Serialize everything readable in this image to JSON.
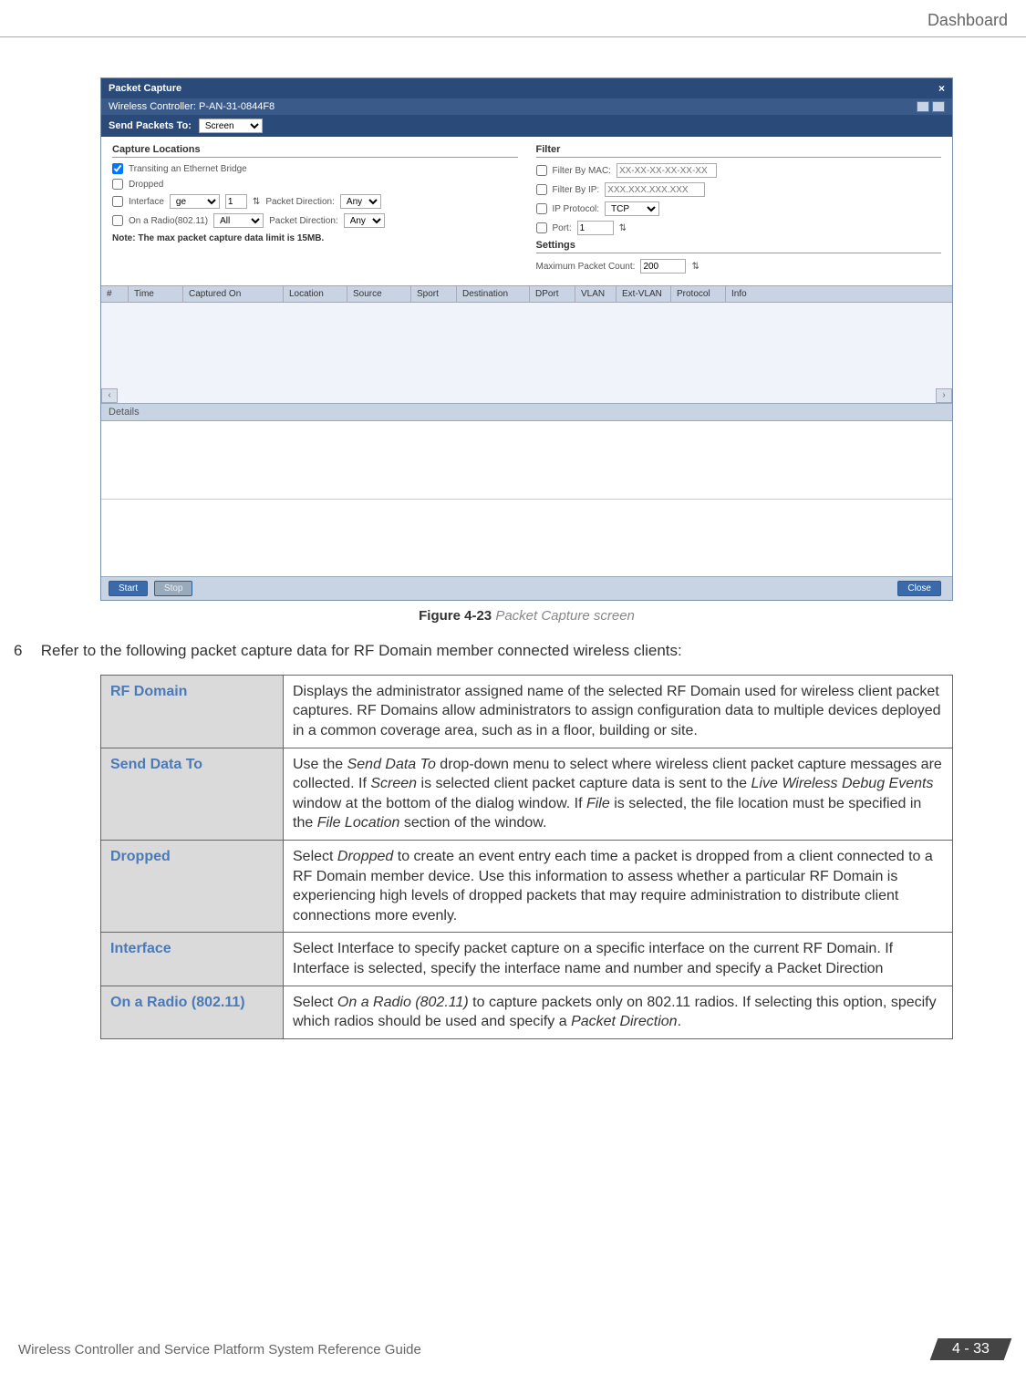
{
  "header": {
    "section": "Dashboard"
  },
  "screenshot": {
    "title": "Packet Capture",
    "controller": "Wireless Controller: P-AN-31-0844F8",
    "send_packets_label": "Send Packets To:",
    "send_packets_value": "Screen",
    "capture_locations": {
      "legend": "Capture Locations",
      "transiting": "Transiting an Ethernet Bridge",
      "dropped": "Dropped",
      "interface": "Interface",
      "interface_val": "ge",
      "interface_num": "1",
      "packet_direction": "Packet Direction:",
      "any": "Any",
      "on_radio": "On a Radio(802.11)",
      "on_radio_val": "All",
      "note": "Note: The max packet capture data limit is 15MB."
    },
    "filter": {
      "legend": "Filter",
      "by_mac": "Filter By MAC:",
      "mac_ph": "XX-XX-XX-XX-XX-XX",
      "by_ip": "Filter By IP:",
      "ip_ph": "XXX.XXX.XXX.XXX",
      "ip_proto": "IP Protocol:",
      "ip_proto_val": "TCP",
      "port": "Port:",
      "port_val": "1",
      "settings": "Settings",
      "max_count": "Maximum Packet Count:",
      "max_count_val": "200"
    },
    "columns": [
      "#",
      "Time",
      "Captured On",
      "Location",
      "Source",
      "Sport",
      "Destination",
      "DPort",
      "VLAN",
      "Ext-VLAN",
      "Protocol",
      "Info"
    ],
    "details": "Details",
    "start": "Start",
    "stop": "Stop",
    "close": "Close"
  },
  "caption": {
    "num": "Figure 4-23",
    "text": " Packet Capture screen"
  },
  "step": {
    "num": "6",
    "text": "Refer to the following packet capture data for RF Domain member connected wireless clients:"
  },
  "def": {
    "rows": [
      {
        "term": "RF Domain",
        "desc": "Displays the administrator assigned name of the selected RF Domain used for wireless client packet captures. RF Domains allow administrators to assign configuration data to multiple devices deployed in a common coverage area, such as in a floor, building or site."
      },
      {
        "term": "Send Data To",
        "desc": "Use the <em>Send Data To</em> drop-down menu to select where wireless client packet capture messages are collected. If <em>Screen</em> is selected client packet capture data is sent to the <em>Live Wireless Debug Events</em> window at the bottom of the dialog window. If <em>File</em> is selected, the file location must be specified in the <em>File Location</em> section of the window."
      },
      {
        "term": "Dropped",
        "desc": "Select <em>Dropped</em> to create an event entry each time a packet is dropped from a client connected to a RF Domain member device. Use this information to assess whether a particular RF Domain is experiencing high levels of dropped packets that may require administration to distribute client connections more evenly."
      },
      {
        "term": "Interface",
        "desc": "Select Interface to specify packet capture on a specific interface on the current RF Domain. If Interface is selected, specify the interface name and number and specify a Packet Direction"
      },
      {
        "term": "On a Radio (802.11)",
        "desc": "Select <em>On a Radio (802.11)</em> to capture packets only on 802.11 radios. If selecting this option, specify which radios should be used and specify a <em>Packet Direction</em>."
      }
    ]
  },
  "footer": {
    "guide": "Wireless Controller and Service Platform System Reference Guide",
    "page": "4 - 33"
  }
}
